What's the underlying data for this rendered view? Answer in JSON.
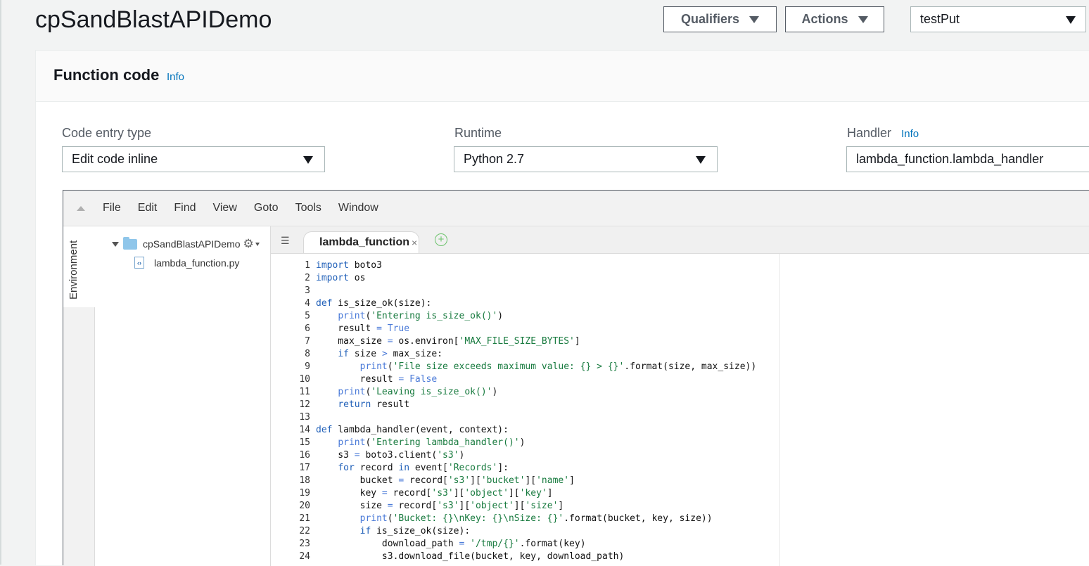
{
  "header": {
    "title": "cpSandBlastAPIDemo",
    "qualifiers_label": "Qualifiers",
    "actions_label": "Actions",
    "test_event_value": "testPut"
  },
  "function_code": {
    "title": "Function code",
    "info": "Info",
    "code_entry_type": {
      "label": "Code entry type",
      "value": "Edit code inline"
    },
    "runtime": {
      "label": "Runtime",
      "value": "Python 2.7"
    },
    "handler": {
      "label": "Handler",
      "info": "Info",
      "value": "lambda_function.lambda_handler"
    }
  },
  "ide": {
    "menu": [
      "File",
      "Edit",
      "Find",
      "View",
      "Goto",
      "Tools",
      "Window"
    ],
    "environment_tab": "Environment",
    "tree": {
      "folder": "cpSandBlastAPIDemo",
      "file": "lambda_function.py"
    },
    "tab_label": "lambda_function",
    "line_numbers": [
      "1",
      "2",
      "3",
      "4",
      "5",
      "6",
      "7",
      "8",
      "9",
      "10",
      "11",
      "12",
      "13",
      "14",
      "15",
      "16",
      "17",
      "18",
      "19",
      "20",
      "21",
      "22",
      "23",
      "24"
    ],
    "code_lines": [
      "import boto3",
      "import os",
      "",
      "def is_size_ok(size):",
      "    print('Entering is_size_ok()')",
      "    result = True",
      "    max_size = os.environ['MAX_FILE_SIZE_BYTES']",
      "    if size > max_size:",
      "        print('File size exceeds maximum value: {} > {}'.format(size, max_size))",
      "        result = False",
      "    print('Leaving is_size_ok()')",
      "    return result",
      "",
      "def lambda_handler(event, context):",
      "    print('Entering lambda_handler()')",
      "    s3 = boto3.client('s3')",
      "    for record in event['Records']:",
      "        bucket = record['s3']['bucket']['name']",
      "        key = record['s3']['object']['key']",
      "        size = record['s3']['object']['size']",
      "        print('Bucket: {}\\nKey: {}\\nSize: {}'.format(bucket, key, size))",
      "        if is_size_ok(size):",
      "            download_path = '/tmp/{}'.format(key)",
      "            s3.download_file(bucket, key, download_path)"
    ]
  }
}
